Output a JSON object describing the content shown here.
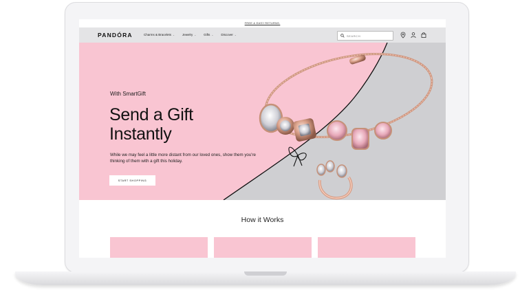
{
  "promo": {
    "text": "FREE & EASY RETURNS."
  },
  "brand": {
    "logo": "PANDÓRA"
  },
  "nav": {
    "items": [
      {
        "label": "Charms & Bracelets"
      },
      {
        "label": "Jewelry"
      },
      {
        "label": "Gifts"
      },
      {
        "label": "Discover"
      }
    ],
    "search": {
      "placeholder": "SEARCH"
    },
    "icons": [
      "search-icon",
      "location-pin-icon",
      "user-icon",
      "shopping-bag-icon"
    ]
  },
  "hero": {
    "eyebrow": "With SmartGift",
    "title_line1": "Send a Gift",
    "title_line2": "Instantly",
    "body": "While we may feel a little more distant from our loved ones, show them you're thinking of them with a gift this holiday.",
    "cta_label": "START SHOPPING"
  },
  "how_it_works": {
    "title": "How it Works"
  },
  "colors": {
    "hero_pink": "#f9c5d2",
    "hero_grey": "#cfcfd2",
    "nav_bg": "#e4e4e6",
    "rose_gold": "#d9a089"
  }
}
